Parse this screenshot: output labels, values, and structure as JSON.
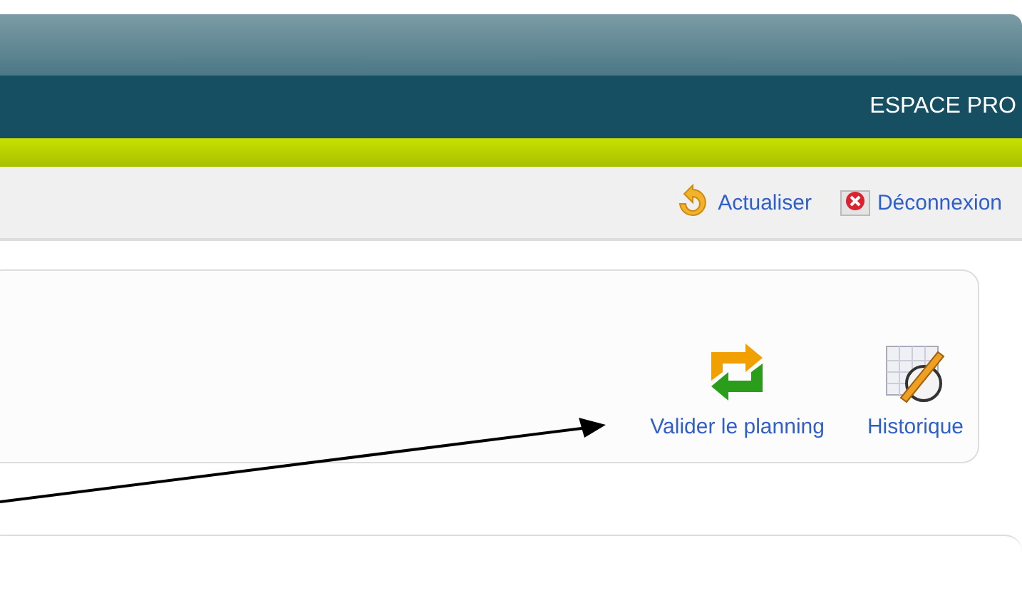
{
  "header": {
    "section_label": "ESPACE PRO"
  },
  "toolbar": {
    "links": [
      {
        "kind": "refresh",
        "label": "Actualiser"
      },
      {
        "kind": "logout",
        "label": "Déconnexion"
      }
    ]
  },
  "actions": [
    {
      "kind": "validate",
      "label": "Valider le planning"
    },
    {
      "kind": "history",
      "label": "Historique"
    }
  ]
}
